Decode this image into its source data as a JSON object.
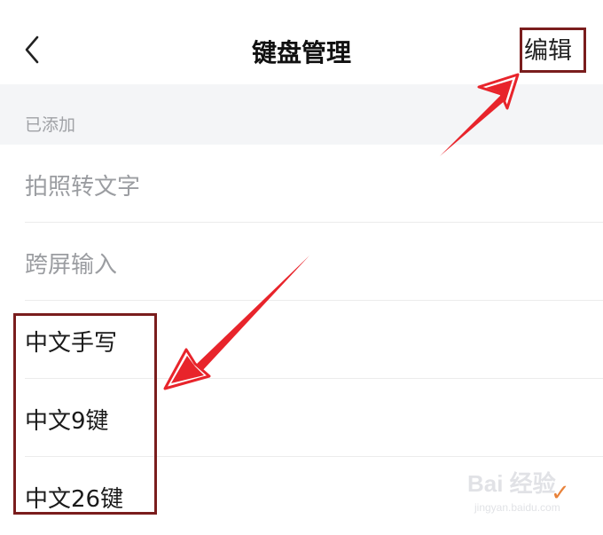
{
  "header": {
    "title": "键盘管理",
    "edit_label": "编辑"
  },
  "section": {
    "label": "已添加"
  },
  "items": [
    {
      "label": "拍照转文字",
      "state": "muted"
    },
    {
      "label": "跨屏输入",
      "state": "muted"
    },
    {
      "label": "中文手写",
      "state": "active"
    },
    {
      "label": "中文9键",
      "state": "active"
    },
    {
      "label": "中文26键",
      "state": "active",
      "selected": true
    }
  ],
  "colors": {
    "annotation_box": "#7a1d1d",
    "annotation_arrow": "#e8242b",
    "check": "#e8823a",
    "section_bg": "#f4f5f7"
  },
  "watermark": {
    "text": "Bai 经验",
    "url_text": "jingyan.baidu.com"
  }
}
